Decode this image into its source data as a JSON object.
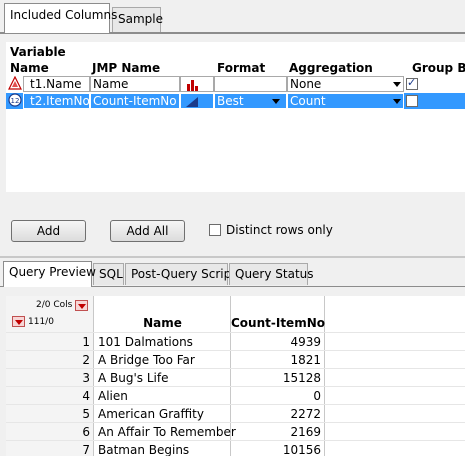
{
  "top_tabs": [
    {
      "label": "Included Columns",
      "active": true
    },
    {
      "label": "Sample",
      "active": false
    }
  ],
  "vargrid": {
    "headers": {
      "variable_line1": "Variable",
      "name": "Name",
      "jmp_name": "JMP Name",
      "format": "Format",
      "aggregation": "Aggregation",
      "group_by": "Group By"
    },
    "rows": [
      {
        "icon": "nominal-icon",
        "name": "t1.Name",
        "jmp_name": "Name",
        "type_icon": "bar-chart-icon",
        "format": "",
        "aggregation": "None",
        "group_by": true,
        "selected": false
      },
      {
        "icon": "continuous-icon",
        "name": "t2.ItemNo",
        "jmp_name": "Count-ItemNo",
        "type_icon": "ramp-icon",
        "format": "Best",
        "aggregation": "Count",
        "group_by": false,
        "selected": true
      }
    ]
  },
  "buttons": {
    "add": "Add",
    "add_all": "Add All",
    "distinct": "Distinct rows only"
  },
  "bottom_tabs": [
    {
      "label": "Query Preview",
      "active": true
    },
    {
      "label": "SQL",
      "active": false
    },
    {
      "label": "Post-Query Script",
      "active": false
    },
    {
      "label": "Query Status",
      "active": false
    }
  ],
  "table": {
    "cols_label": "2/0 Cols",
    "rows_label": "111/0",
    "headers": [
      "Name",
      "Count-ItemNo"
    ],
    "rows": [
      {
        "n": "1",
        "name": "101 Dalmations",
        "count": "4939"
      },
      {
        "n": "2",
        "name": "A Bridge Too Far",
        "count": "1821"
      },
      {
        "n": "3",
        "name": "A Bug's Life",
        "count": "15128"
      },
      {
        "n": "4",
        "name": "Alien",
        "count": "0"
      },
      {
        "n": "5",
        "name": "American Graffity",
        "count": "2272"
      },
      {
        "n": "6",
        "name": "An Affair To Remember",
        "count": "2169"
      },
      {
        "n": "7",
        "name": "Batman Begins",
        "count": "10156"
      }
    ]
  },
  "colors": {
    "selection": "#3399ff",
    "red_accent": "#c00000"
  }
}
